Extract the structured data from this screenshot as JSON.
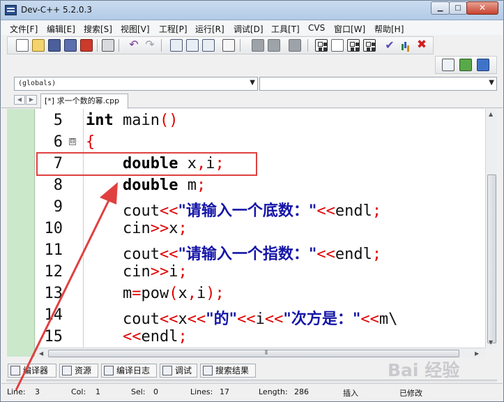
{
  "window": {
    "title": "Dev-C++ 5.2.0.3"
  },
  "menu": [
    "文件[F]",
    "编辑[E]",
    "搜索[S]",
    "视图[V]",
    "工程[P]",
    "运行[R]",
    "调试[D]",
    "工具[T]",
    "CVS",
    "窗口[W]",
    "帮助[H]"
  ],
  "scope_combo": {
    "value": "(globals)"
  },
  "symbol_combo": {
    "value": ""
  },
  "file_tab": {
    "label": "[*] 求一个数的幂.cpp"
  },
  "editor": {
    "line_numbers": [
      "5",
      "6",
      "7",
      "8",
      "9",
      "10",
      "11",
      "12",
      "13",
      "14",
      "15"
    ],
    "fold_marker": "⊟",
    "code": [
      {
        "kw": "int",
        "rest": " main",
        "sym": "()"
      },
      {
        "sym": "{"
      },
      {
        "indent": "    ",
        "kw": "double",
        "rest": " x",
        "sym1": ",",
        "rest2": "i",
        "sym": ";"
      },
      {
        "indent": "    ",
        "kw": "double",
        "rest": " m",
        "sym": ";"
      },
      {
        "indent": "    ",
        "rest": "cout",
        "sym": "<<",
        "str": "\"请输入一个底数：\"",
        "sym2": "<<",
        "rest2": "endl",
        "sym3": ";"
      },
      {
        "indent": "    ",
        "rest": "cin",
        "sym": ">>",
        "rest2": "x",
        "sym2": ";"
      },
      {
        "indent": "    ",
        "rest": "cout",
        "sym": "<<",
        "str": "\"请输入一个指数：\"",
        "sym2": "<<",
        "rest2": "endl",
        "sym3": ";"
      },
      {
        "indent": "    ",
        "rest": "cin",
        "sym": ">>",
        "rest2": "i",
        "sym2": ";"
      },
      {
        "indent": "    ",
        "rest": "m",
        "sym": "=",
        "rest2": "pow",
        "sym2": "(",
        "rest3": "x",
        "sym3": ",",
        "rest4": "i",
        "sym4": ");"
      },
      {
        "indent": "    ",
        "rest": "cout",
        "sym": "<<",
        "rest2": "x",
        "sym2": "<<",
        "str": "\"的\"",
        "sym3": "<<",
        "rest3": "i",
        "sym4": "<<",
        "str2": "\"次方是：\"",
        "sym5": "<<",
        "rest4": "m\\"
      },
      {
        "indent": "    ",
        "sym": "<<",
        "rest": "endl",
        "sym2": ";"
      }
    ]
  },
  "bottom_tabs": [
    "编译器",
    "资源",
    "编译日志",
    "调试",
    "搜索结果"
  ],
  "status": {
    "line_label": "Line:",
    "line_value": "3",
    "col_label": "Col:",
    "col_value": "1",
    "sel_label": "Sel:",
    "sel_value": "0",
    "lines_label": "Lines:",
    "lines_value": "17",
    "length_label": "Length:",
    "length_value": "286",
    "insert_mode": "插入",
    "modified": "已修改"
  },
  "watermark": "Bai 经验",
  "colors": {
    "keyword": "#000000",
    "symbol": "#e00000",
    "string": "#1515a8",
    "gutter_panel": "#cbe8cb",
    "highlight": "#e04040"
  },
  "icons": [
    "new-file-icon",
    "open-icon",
    "save-icon",
    "save-all-icon",
    "close-file-icon",
    "print-icon",
    "undo-icon",
    "redo-icon",
    "find-icon",
    "replace-icon",
    "find-next-icon",
    "goto-line-icon",
    "compile-icon",
    "run-icon",
    "compile-run-icon",
    "rebuild-icon",
    "debug-icon",
    "profile-icon",
    "stop-icon",
    "project-new-icon",
    "project-add-icon",
    "project-options-icon"
  ]
}
